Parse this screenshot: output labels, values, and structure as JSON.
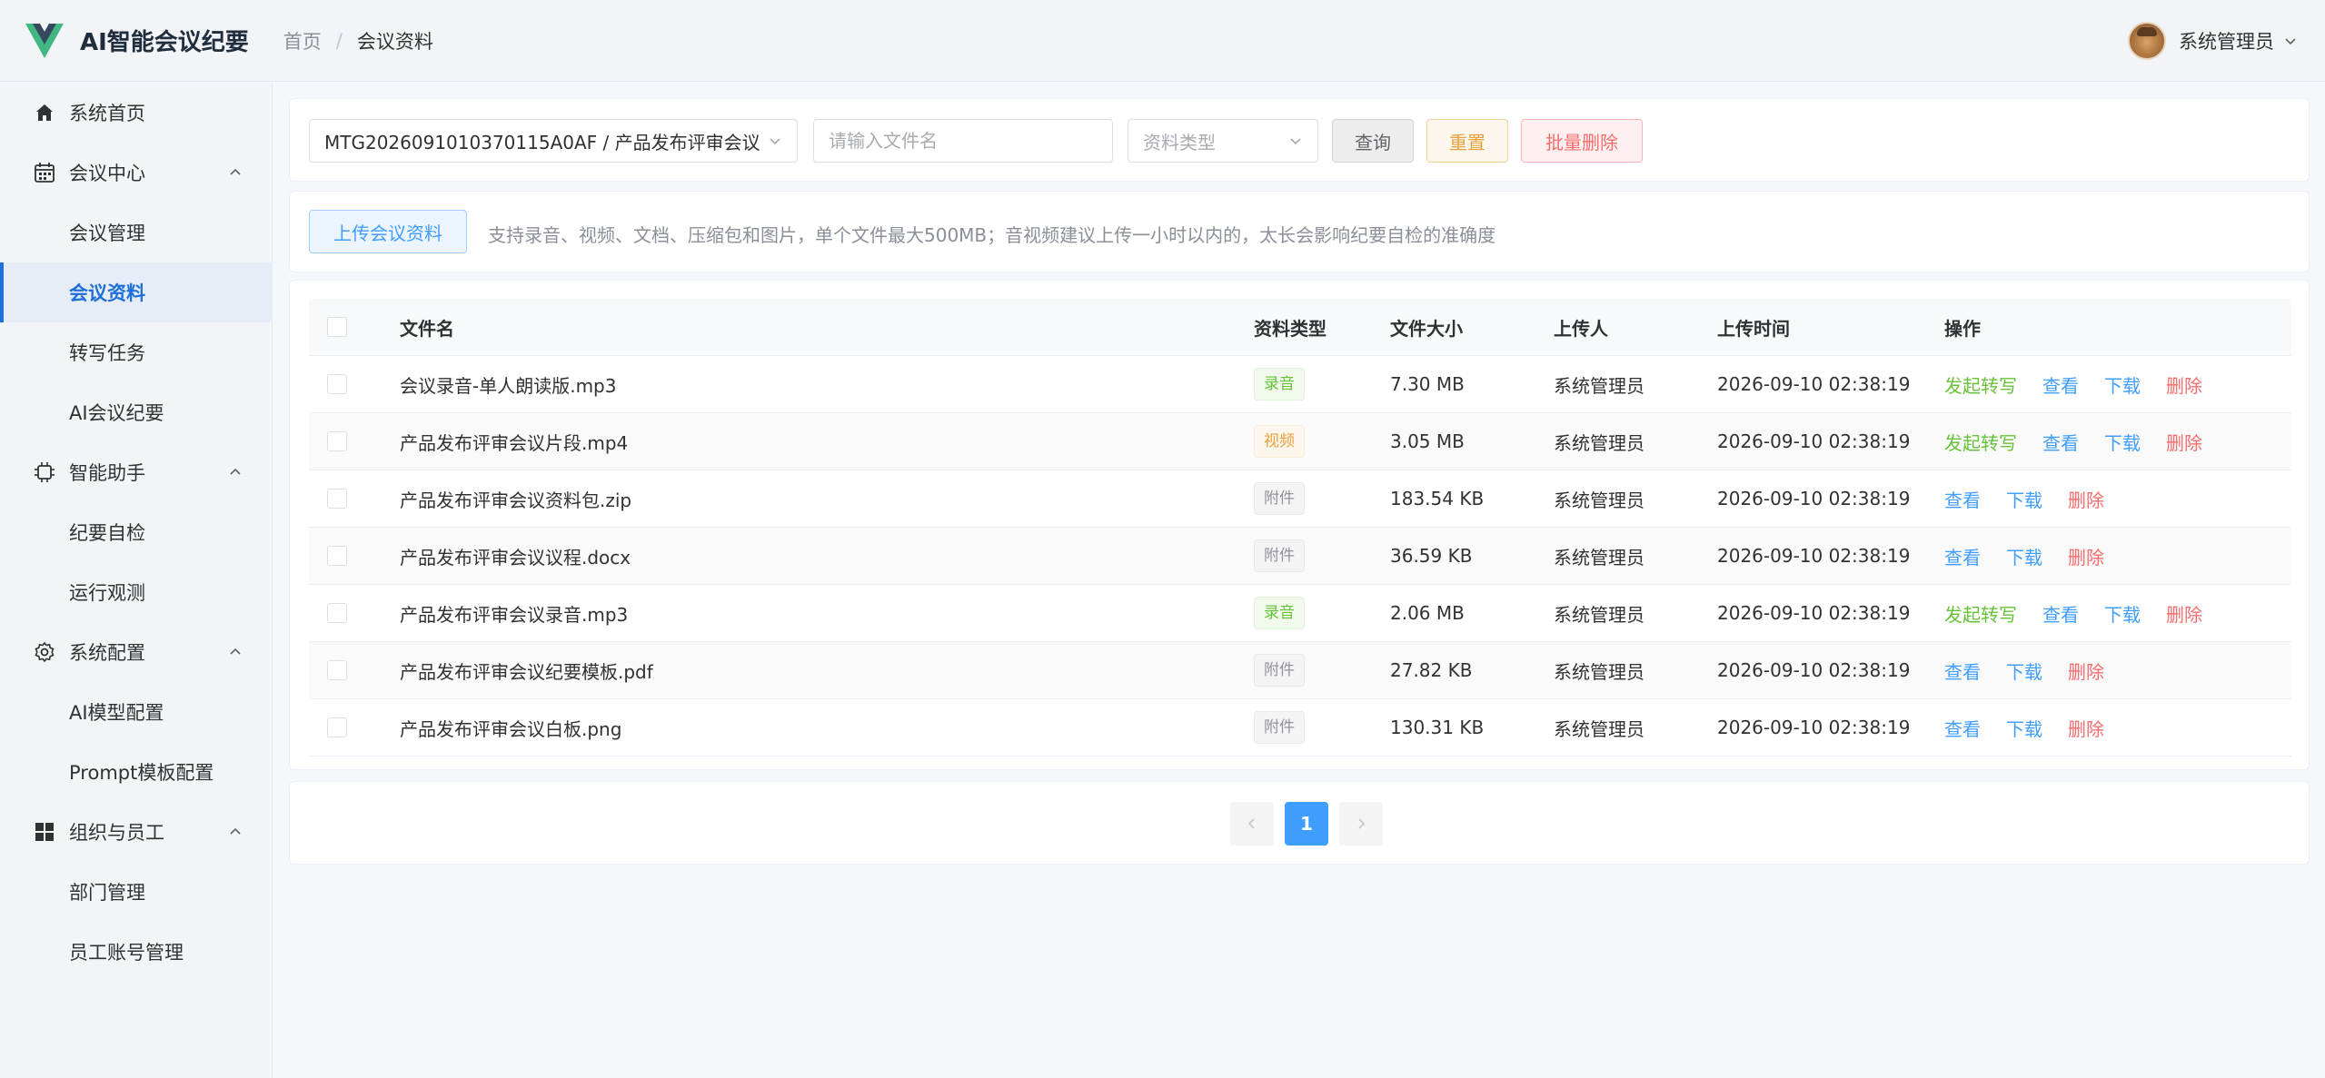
{
  "app": {
    "title": "AI智能会议纪要"
  },
  "breadcrumb": {
    "home": "首页",
    "separator": "/",
    "current": "会议资料"
  },
  "user": {
    "name": "系统管理员"
  },
  "sidebar": {
    "items": [
      {
        "label": "系统首页",
        "icon": "home-icon",
        "type": "item"
      },
      {
        "label": "会议中心",
        "icon": "calendar-icon",
        "type": "group"
      },
      {
        "label": "会议管理",
        "type": "sub"
      },
      {
        "label": "会议资料",
        "type": "sub",
        "active": true
      },
      {
        "label": "转写任务",
        "type": "sub"
      },
      {
        "label": "AI会议纪要",
        "type": "sub"
      },
      {
        "label": "智能助手",
        "icon": "chip-icon",
        "type": "group"
      },
      {
        "label": "纪要自检",
        "type": "sub"
      },
      {
        "label": "运行观测",
        "type": "sub"
      },
      {
        "label": "系统配置",
        "icon": "gear-icon",
        "type": "group"
      },
      {
        "label": "AI模型配置",
        "type": "sub"
      },
      {
        "label": "Prompt模板配置",
        "type": "sub"
      },
      {
        "label": "组织与员工",
        "icon": "grid-icon",
        "type": "group"
      },
      {
        "label": "部门管理",
        "type": "sub"
      },
      {
        "label": "员工账号管理",
        "type": "sub"
      }
    ]
  },
  "filters": {
    "meeting_select": "MTG2026091010370115A0AF / 产品发布评审会议",
    "filename_placeholder": "请输入文件名",
    "type_placeholder": "资料类型",
    "query_label": "查询",
    "reset_label": "重置",
    "batch_delete_label": "批量删除"
  },
  "upload": {
    "button_label": "上传会议资料",
    "hint": "支持录音、视频、文档、压缩包和图片，单个文件最大500MB；音视频建议上传一小时以内的，太长会影响纪要自检的准确度"
  },
  "table": {
    "headers": {
      "name": "文件名",
      "type": "资料类型",
      "size": "文件大小",
      "uploader": "上传人",
      "time": "上传时间",
      "ops": "操作"
    },
    "rows": [
      {
        "name": "会议录音-单人朗读版.mp3",
        "type": "录音",
        "type_color": "green",
        "size": "7.30 MB",
        "uploader": "系统管理员",
        "time": "2026-09-10 02:38:19",
        "ops": [
          "发起转写",
          "查看",
          "下载",
          "删除"
        ]
      },
      {
        "name": "产品发布评审会议片段.mp4",
        "type": "视频",
        "type_color": "orange",
        "size": "3.05 MB",
        "uploader": "系统管理员",
        "time": "2026-09-10 02:38:19",
        "ops": [
          "发起转写",
          "查看",
          "下载",
          "删除"
        ]
      },
      {
        "name": "产品发布评审会议资料包.zip",
        "type": "附件",
        "type_color": "gray",
        "size": "183.54 KB",
        "uploader": "系统管理员",
        "time": "2026-09-10 02:38:19",
        "ops": [
          "查看",
          "下载",
          "删除"
        ]
      },
      {
        "name": "产品发布评审会议议程.docx",
        "type": "附件",
        "type_color": "gray",
        "size": "36.59 KB",
        "uploader": "系统管理员",
        "time": "2026-09-10 02:38:19",
        "ops": [
          "查看",
          "下载",
          "删除"
        ]
      },
      {
        "name": "产品发布评审会议录音.mp3",
        "type": "录音",
        "type_color": "green",
        "size": "2.06 MB",
        "uploader": "系统管理员",
        "time": "2026-09-10 02:38:19",
        "ops": [
          "发起转写",
          "查看",
          "下载",
          "删除"
        ]
      },
      {
        "name": "产品发布评审会议纪要模板.pdf",
        "type": "附件",
        "type_color": "gray",
        "size": "27.82 KB",
        "uploader": "系统管理员",
        "time": "2026-09-10 02:38:19",
        "ops": [
          "查看",
          "下载",
          "删除"
        ]
      },
      {
        "name": "产品发布评审会议白板.png",
        "type": "附件",
        "type_color": "gray",
        "size": "130.31 KB",
        "uploader": "系统管理员",
        "time": "2026-09-10 02:38:19",
        "ops": [
          "查看",
          "下载",
          "删除"
        ]
      }
    ]
  },
  "pagination": {
    "current_page": "1"
  },
  "colors": {
    "primary": "#409eff",
    "success": "#67c23a",
    "warning": "#e6a23c",
    "danger": "#f56c6c",
    "active_menu": "#1e6fd9"
  }
}
